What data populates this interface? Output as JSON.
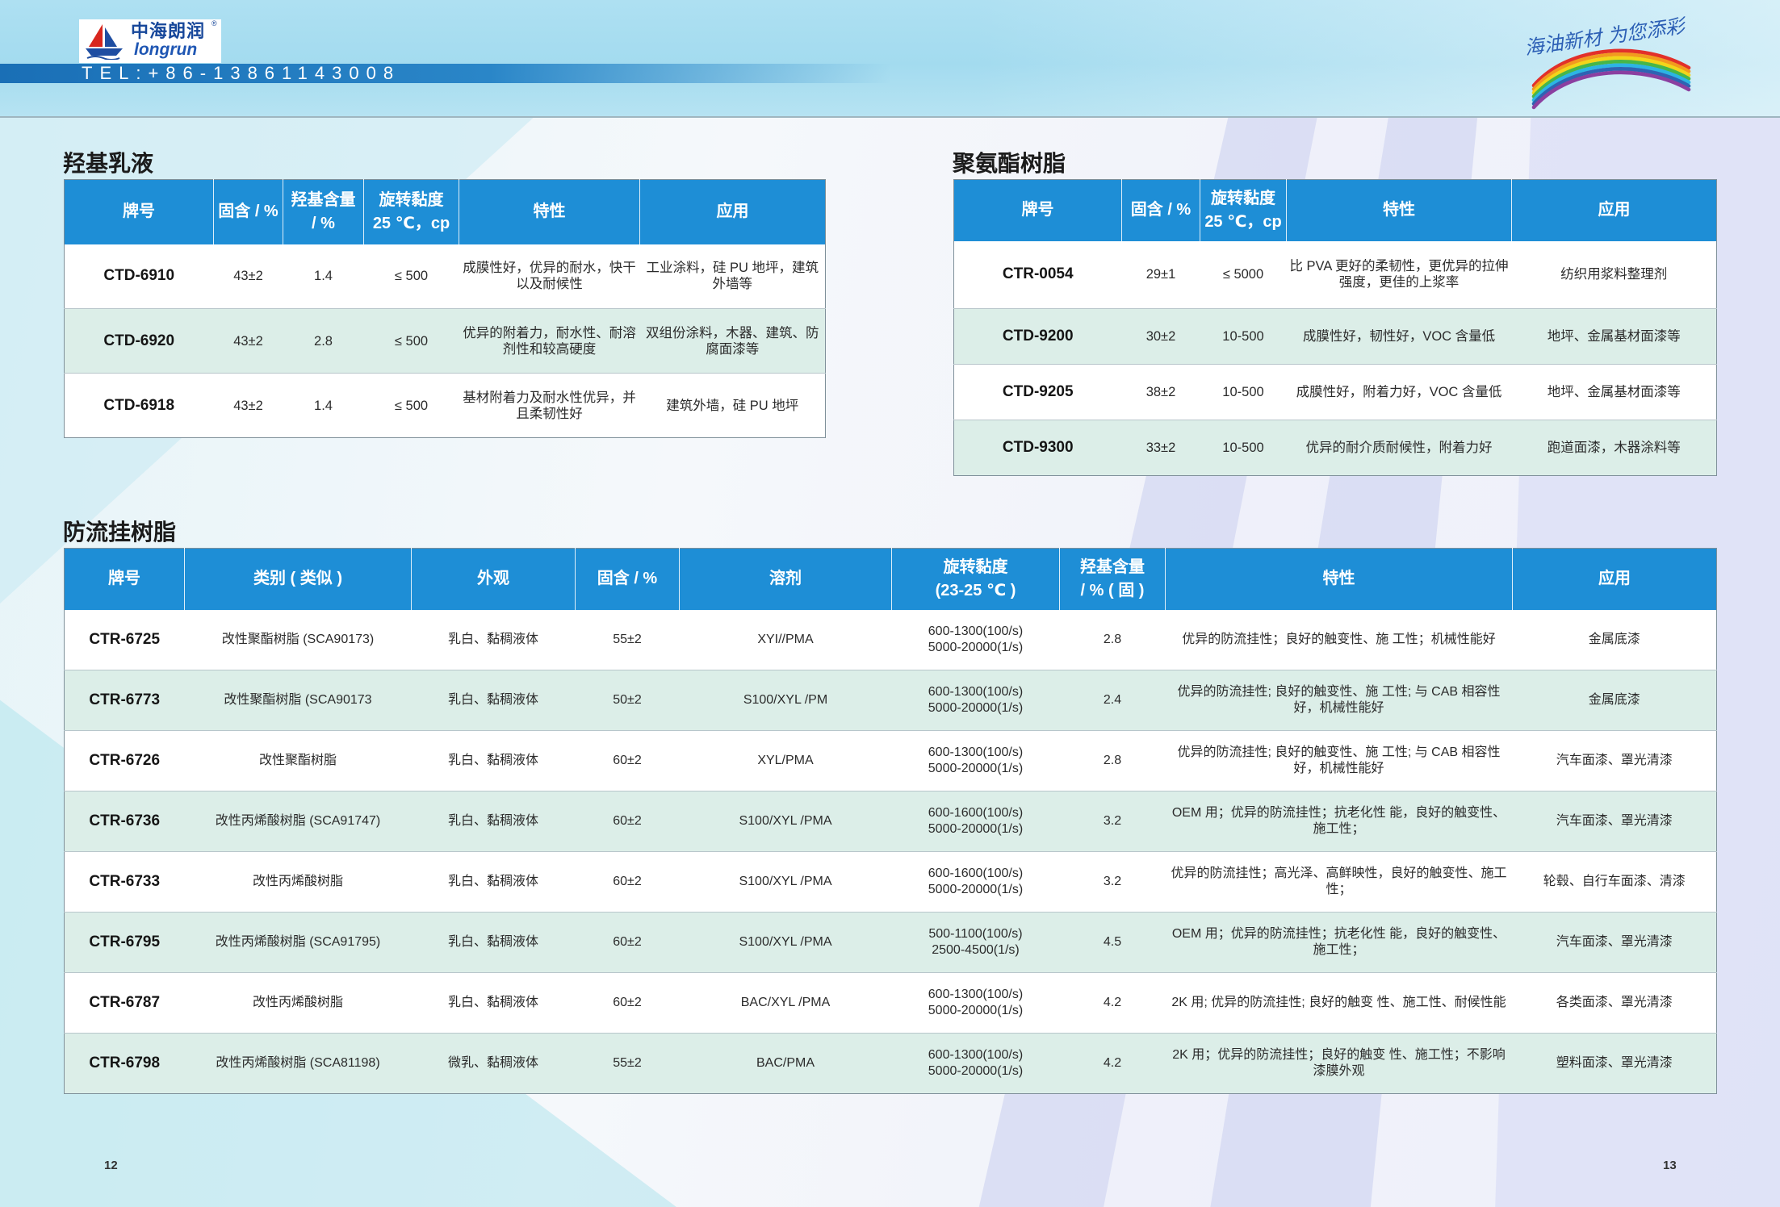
{
  "header": {
    "brand_cn": "中海朗润",
    "reg_mark": "®",
    "brand_en": "longrun",
    "phone": "TEL:+86-13861143008",
    "slogan": "海油新材 为您添彩"
  },
  "colors": {
    "header_blue": "#1e8ed6",
    "alt_row": "#dceee8"
  },
  "hydroxyl_emulsion": {
    "title": "羟基乳液",
    "columns": [
      "牌号",
      "固含 / %",
      "羟基含量\n/ %",
      "旋转黏度\n25 ℃，cp",
      "特性",
      "应用"
    ],
    "rows": [
      [
        "CTD-6910",
        "43±2",
        "1.4",
        "≤ 500",
        "成膜性好，优异的耐水，快干以及耐候性",
        "工业涂料，硅 PU 地坪，建筑外墙等"
      ],
      [
        "CTD-6920",
        "43±2",
        "2.8",
        "≤ 500",
        "优异的附着力，耐水性、耐溶剂性和较高硬度",
        "双组份涂料，木器、建筑、防腐面漆等"
      ],
      [
        "CTD-6918",
        "43±2",
        "1.4",
        "≤ 500",
        "基材附着力及耐水性优异，并且柔韧性好",
        "建筑外墙，硅 PU 地坪"
      ]
    ]
  },
  "polyurethane": {
    "title": "聚氨酯树脂",
    "columns": [
      "牌号",
      "固含 / %",
      "旋转黏度\n25 ℃，cp",
      "特性",
      "应用"
    ],
    "rows": [
      [
        "CTR-0054",
        "29±1",
        "≤ 5000",
        "比 PVA 更好的柔韧性，更优异的拉伸强度，更佳的上浆率",
        "纺织用浆料整理剂"
      ],
      [
        "CTD-9200",
        "30±2",
        "10-500",
        "成膜性好，韧性好，VOC 含量低",
        "地坪、金属基材面漆等"
      ],
      [
        "CTD-9205",
        "38±2",
        "10-500",
        "成膜性好，附着力好，VOC 含量低",
        "地坪、金属基材面漆等"
      ],
      [
        "CTD-9300",
        "33±2",
        "10-500",
        "优异的耐介质耐候性，附着力好",
        "跑道面漆，木器涂料等"
      ]
    ]
  },
  "anti_sag": {
    "title": "防流挂树脂",
    "columns": [
      "牌号",
      "类别 ( 类似 )",
      "外观",
      "固含 / %",
      "溶剂",
      "旋转黏度\n(23-25 ℃ )",
      "羟基含量\n/ % ( 固 )",
      "特性",
      "应用"
    ],
    "rows": [
      [
        "CTR-6725",
        "改性聚酯树脂 (SCA90173)",
        "乳白、黏稠液体",
        "55±2",
        "XYI//PMA",
        "600-1300(100/s)\n5000-20000(1/s)",
        "2.8",
        "优异的防流挂性；良好的触变性、施 工性；机械性能好",
        "金属底漆"
      ],
      [
        "CTR-6773",
        "改性聚酯树脂 (SCA90173",
        "乳白、黏稠液体",
        "50±2",
        "S100/XYL /PM",
        "600-1300(100/s)\n5000-20000(1/s)",
        "2.4",
        "优异的防流挂性; 良好的触变性、施 工性; 与 CAB 相容性好，机械性能好",
        "金属底漆"
      ],
      [
        "CTR-6726",
        "改性聚酯树脂",
        "乳白、黏稠液体",
        "60±2",
        "XYL/PMA",
        "600-1300(100/s)\n5000-20000(1/s)",
        "2.8",
        "优异的防流挂性; 良好的触变性、施 工性; 与 CAB 相容性好，机械性能好",
        "汽车面漆、罩光清漆"
      ],
      [
        "CTR-6736",
        "改性丙烯酸树脂 (SCA91747)",
        "乳白、黏稠液体",
        "60±2",
        "S100/XYL /PMA",
        "600-1600(100/s)\n5000-20000(1/s)",
        "3.2",
        "OEM 用；优异的防流挂性；抗老化性 能，良好的触变性、施工性；",
        "汽车面漆、罩光清漆"
      ],
      [
        "CTR-6733",
        "改性丙烯酸树脂",
        "乳白、黏稠液体",
        "60±2",
        "S100/XYL /PMA",
        "600-1600(100/s)\n5000-20000(1/s)",
        "3.2",
        "优异的防流挂性；高光泽、高鲜映性，良好的触变性、施工性；",
        "轮毂、自行车面漆、清漆"
      ],
      [
        "CTR-6795",
        "改性丙烯酸树脂 (SCA91795)",
        "乳白、黏稠液体",
        "60±2",
        "S100/XYL /PMA",
        "500-1100(100/s)\n2500-4500(1/s)",
        "4.5",
        "OEM 用；优异的防流挂性；抗老化性 能，良好的触变性、施工性；",
        "汽车面漆、罩光清漆"
      ],
      [
        "CTR-6787",
        "改性丙烯酸树脂",
        "乳白、黏稠液体",
        "60±2",
        "BAC/XYL /PMA",
        "600-1300(100/s)\n5000-20000(1/s)",
        "4.2",
        "2K 用; 优异的防流挂性; 良好的触变 性、施工性、耐候性能",
        "各类面漆、罩光清漆"
      ],
      [
        "CTR-6798",
        "改性丙烯酸树脂 (SCA81198)",
        "微乳、黏稠液体",
        "55±2",
        "BAC/PMA",
        "600-1300(100/s)\n5000-20000(1/s)",
        "4.2",
        "2K 用；优异的防流挂性；良好的触变 性、施工性；不影响漆膜外观",
        "塑料面漆、罩光清漆"
      ]
    ]
  },
  "page_numbers": {
    "left": "12",
    "right": "13"
  }
}
